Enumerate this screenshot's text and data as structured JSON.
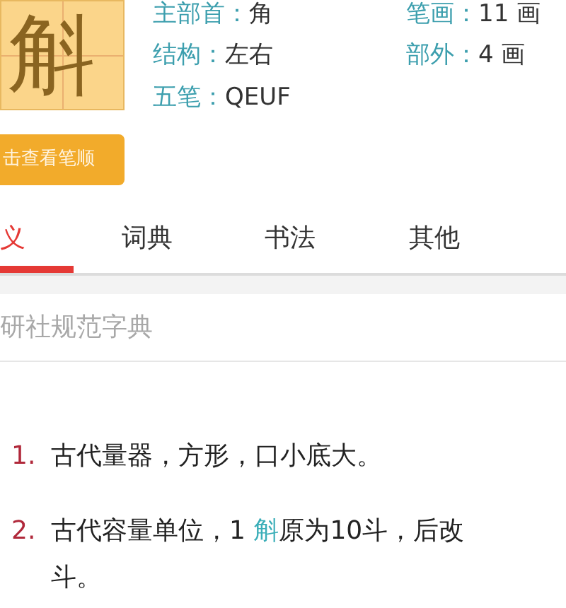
{
  "character": {
    "glyph": "斛"
  },
  "info": [
    {
      "label": "主部首：",
      "value": "角"
    },
    {
      "label": "笔画：",
      "value": "11 画"
    },
    {
      "label": "结构：",
      "value": "左右"
    },
    {
      "label": "部外：",
      "value": "4 画"
    },
    {
      "label": "五笔：",
      "value": "QEUF"
    }
  ],
  "stroke_button": "击查看笔顺",
  "tabs": [
    {
      "label": "义",
      "selected": true
    },
    {
      "label": "词典",
      "selected": false
    },
    {
      "label": "书法",
      "selected": false
    },
    {
      "label": "其他",
      "selected": false
    }
  ],
  "source": "研社规范字典",
  "definitions": [
    {
      "number": "1.",
      "lines": [
        [
          {
            "kind": "plain",
            "text": "古代量器，方形，口小底大。"
          }
        ]
      ]
    },
    {
      "number": "2.",
      "lines": [
        [
          {
            "kind": "plain",
            "text": "古代容量单位，1 "
          },
          {
            "kind": "link",
            "text": "斛"
          },
          {
            "kind": "plain",
            "text": "原为10斗，后改"
          }
        ],
        [
          {
            "kind": "plain",
            "text": "斗。"
          }
        ]
      ]
    }
  ]
}
